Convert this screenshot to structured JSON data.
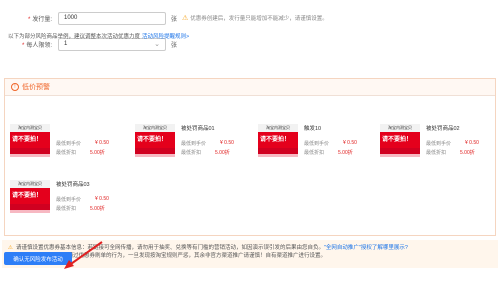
{
  "form": {
    "issue": {
      "label": "发行量:",
      "value": "1000",
      "unit": "张",
      "hint": "优惠券创建后，发行量只能增加不能减少，请谨慎设置。"
    },
    "limit": {
      "label": "每人限领:",
      "value": "1",
      "unit": "张"
    }
  },
  "warning": {
    "title": "低价预警",
    "subtitle": "以下为部分风险商品举例，建议调整本次活动优惠力度",
    "rules_link": "活动风险提醒规则>",
    "price_label": "最低到手价",
    "discount_label": "最低折扣",
    "products": [
      {
        "thumb_top": "淘宝内测宝贝",
        "thumb_tag": "请不要拍！",
        "name": "",
        "price": "¥ 0.50",
        "discount": "5.00折"
      },
      {
        "thumb_top": "淘宝内测宝贝",
        "thumb_tag": "请不要拍！",
        "name": "被处罚商品01",
        "price": "¥ 0.50",
        "discount": "5.00折"
      },
      {
        "thumb_top": "淘宝内测宝贝",
        "thumb_tag": "请不要拍！",
        "name": "触发10",
        "price": "¥ 0.50",
        "discount": "5.00折"
      },
      {
        "thumb_top": "淘宝内测宝贝",
        "thumb_tag": "请不要拍！",
        "name": "被处罚商品02",
        "price": "¥ 0.50",
        "discount": "5.00折"
      },
      {
        "thumb_top": "淘宝内测宝贝",
        "thumb_tag": "请不要拍！",
        "name": "被处罚商品03",
        "price": "¥ 0.50",
        "discount": "5.00折"
      }
    ]
  },
  "note": {
    "line1_prefix": "请谨慎设置优惠券基本信息：若链接可全网传播，请勿用于抽奖、兑换等有门槛的营销活动，如因演示误引发的后果由您自负。",
    "line1_link": "\"全网自动推广\"授权了解哪里展示?",
    "line2": "特别提醒：严令禁止通过优惠券刷单的行为，一旦发现按淘宝规则严惩，其余非官方渠道推广请谨慎！自有渠道推广进行设置。"
  },
  "submit_label": "确认无风险发布活动"
}
